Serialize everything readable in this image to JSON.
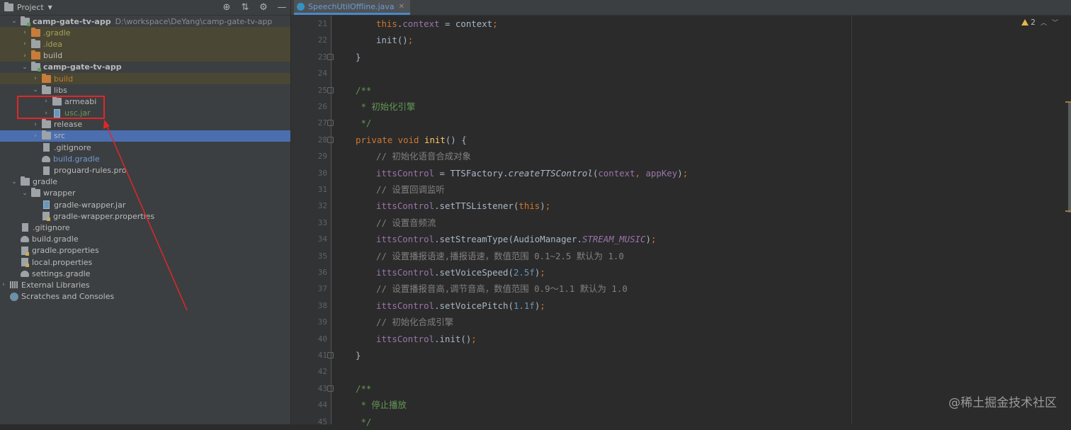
{
  "project_panel": {
    "title": "Project",
    "dropdown_icon": "chevron-down-icon",
    "toolbar_icons": [
      "locate-icon",
      "collapse-icon",
      "gear-icon",
      "minimize-icon"
    ],
    "tree": [
      {
        "label": "camp-gate-tv-app",
        "path": "D:\\workspace\\DeYang\\camp-gate-tv-app",
        "indent": 0,
        "expanded": true,
        "icon": "module-folder-icon",
        "style": "bold"
      },
      {
        "label": ".gradle",
        "indent": 1,
        "expanded": false,
        "icon": "folder-orange-icon",
        "style": "olive",
        "hl": true
      },
      {
        "label": ".idea",
        "indent": 1,
        "expanded": false,
        "icon": "folder-icon",
        "style": "olive",
        "hl": true
      },
      {
        "label": "build",
        "indent": 1,
        "expanded": false,
        "icon": "folder-orange-icon",
        "style": "normal",
        "hl": true
      },
      {
        "label": "camp-gate-tv-app",
        "indent": 1,
        "expanded": true,
        "icon": "module-folder-icon",
        "style": "bold"
      },
      {
        "label": "build",
        "indent": 2,
        "expanded": false,
        "icon": "folder-orange-icon",
        "style": "orange",
        "hl": true
      },
      {
        "label": "libs",
        "indent": 2,
        "expanded": true,
        "icon": "folder-icon",
        "style": "normal"
      },
      {
        "label": "armeabi",
        "indent": 3,
        "expanded": false,
        "icon": "folder-icon",
        "style": "normal"
      },
      {
        "label": "usc.jar",
        "indent": 3,
        "expanded": false,
        "icon": "jar-icon",
        "style": "green"
      },
      {
        "label": "release",
        "indent": 2,
        "expanded": false,
        "icon": "folder-icon",
        "style": "normal"
      },
      {
        "label": "src",
        "indent": 2,
        "expanded": false,
        "icon": "folder-icon",
        "style": "normal",
        "selected": true
      },
      {
        "label": ".gitignore",
        "indent": 2,
        "icon": "file-icon",
        "style": "normal"
      },
      {
        "label": "build.gradle",
        "indent": 2,
        "icon": "gradle-icon",
        "style": "blue"
      },
      {
        "label": "proguard-rules.pro",
        "indent": 2,
        "icon": "file-icon",
        "style": "normal"
      },
      {
        "label": "gradle",
        "indent": 0,
        "expanded": true,
        "icon": "folder-icon",
        "style": "normal"
      },
      {
        "label": "wrapper",
        "indent": 1,
        "expanded": true,
        "icon": "folder-icon",
        "style": "normal"
      },
      {
        "label": "gradle-wrapper.jar",
        "indent": 2,
        "icon": "jar-icon",
        "style": "normal"
      },
      {
        "label": "gradle-wrapper.properties",
        "indent": 2,
        "icon": "properties-icon",
        "style": "normal"
      },
      {
        "label": ".gitignore",
        "indent": 0,
        "icon": "file-icon",
        "style": "normal"
      },
      {
        "label": "build.gradle",
        "indent": 0,
        "icon": "gradle-icon",
        "style": "normal"
      },
      {
        "label": "gradle.properties",
        "indent": 0,
        "icon": "properties-icon",
        "style": "normal"
      },
      {
        "label": "local.properties",
        "indent": 0,
        "icon": "properties-icon",
        "style": "normal"
      },
      {
        "label": "settings.gradle",
        "indent": 0,
        "icon": "gradle-icon",
        "style": "normal"
      },
      {
        "label": "External Libraries",
        "indent": -1,
        "expanded": false,
        "icon": "libraries-icon",
        "style": "normal"
      },
      {
        "label": "Scratches and Consoles",
        "indent": -1,
        "icon": "scratches-icon",
        "style": "normal"
      }
    ]
  },
  "editor": {
    "tab": {
      "label": "SpeechUtilOffline.java",
      "close_icon": "close-icon"
    },
    "warnings": {
      "icon": "warning-icon",
      "count": "2"
    },
    "watermark": "@稀土掘金技术社区",
    "lines": [
      {
        "n": "21",
        "indent": 2,
        "parts": [
          [
            "kw",
            "this"
          ],
          [
            "p",
            "."
          ],
          [
            "fld",
            "context"
          ],
          [
            "p",
            " = context"
          ],
          [
            "kw",
            ";"
          ]
        ]
      },
      {
        "n": "22",
        "indent": 2,
        "parts": [
          [
            "fn2",
            "init"
          ],
          [
            "p",
            "()"
          ],
          [
            "kw",
            ";"
          ]
        ]
      },
      {
        "n": "23",
        "indent": 1,
        "parts": [
          [
            "p",
            "}"
          ]
        ]
      },
      {
        "n": "24",
        "indent": 0,
        "parts": []
      },
      {
        "n": "25",
        "indent": 1,
        "parts": [
          [
            "doc",
            "/**"
          ]
        ]
      },
      {
        "n": "26",
        "indent": 1,
        "parts": [
          [
            "doc",
            " * 初始化引擎"
          ]
        ]
      },
      {
        "n": "27",
        "indent": 1,
        "parts": [
          [
            "doc",
            " */"
          ]
        ]
      },
      {
        "n": "28",
        "indent": 1,
        "parts": [
          [
            "kw",
            "private void "
          ],
          [
            "fn",
            "init"
          ],
          [
            "p",
            "() {"
          ]
        ]
      },
      {
        "n": "29",
        "indent": 2,
        "parts": [
          [
            "cmt",
            "// 初始化语音合成对象"
          ]
        ]
      },
      {
        "n": "30",
        "indent": 2,
        "parts": [
          [
            "fld",
            "ittsControl"
          ],
          [
            "p",
            " = TTSFactory."
          ],
          [
            "it",
            "createTTSControl"
          ],
          [
            "p",
            "("
          ],
          [
            "fld",
            "context"
          ],
          [
            "kw",
            ", "
          ],
          [
            "fld",
            "appKey"
          ],
          [
            "p",
            ")"
          ],
          [
            "kw",
            ";"
          ]
        ]
      },
      {
        "n": "31",
        "indent": 2,
        "parts": [
          [
            "cmt",
            "// 设置回调监听"
          ]
        ]
      },
      {
        "n": "32",
        "indent": 2,
        "parts": [
          [
            "fld",
            "ittsControl"
          ],
          [
            "p",
            ".setTTSListener("
          ],
          [
            "kw",
            "this"
          ],
          [
            "p",
            ")"
          ],
          [
            "kw",
            ";"
          ]
        ]
      },
      {
        "n": "33",
        "indent": 2,
        "parts": [
          [
            "cmt",
            "// 设置音频流"
          ]
        ]
      },
      {
        "n": "34",
        "indent": 2,
        "parts": [
          [
            "fld",
            "ittsControl"
          ],
          [
            "p",
            ".setStreamType(AudioManager."
          ],
          [
            "stat",
            "STREAM_MUSIC"
          ],
          [
            "p",
            ")"
          ],
          [
            "kw",
            ";"
          ]
        ]
      },
      {
        "n": "35",
        "indent": 2,
        "parts": [
          [
            "cmt",
            "// 设置播报语速,播报语速，数值范围 0.1~2.5 默认为 1.0"
          ]
        ]
      },
      {
        "n": "36",
        "indent": 2,
        "parts": [
          [
            "fld",
            "ittsControl"
          ],
          [
            "p",
            ".setVoiceSpeed("
          ],
          [
            "num",
            "2.5f"
          ],
          [
            "p",
            ")"
          ],
          [
            "kw",
            ";"
          ]
        ]
      },
      {
        "n": "37",
        "indent": 2,
        "parts": [
          [
            "cmt",
            "// 设置播报音高,调节音高，数值范围 0.9～1.1 默认为 1.0"
          ]
        ]
      },
      {
        "n": "38",
        "indent": 2,
        "parts": [
          [
            "fld",
            "ittsControl"
          ],
          [
            "p",
            ".setVoicePitch("
          ],
          [
            "num",
            "1.1f"
          ],
          [
            "p",
            ")"
          ],
          [
            "kw",
            ";"
          ]
        ]
      },
      {
        "n": "39",
        "indent": 2,
        "parts": [
          [
            "cmt",
            "// 初始化合成引擎"
          ]
        ]
      },
      {
        "n": "40",
        "indent": 2,
        "parts": [
          [
            "fld",
            "ittsControl"
          ],
          [
            "p",
            ".init()"
          ],
          [
            "kw",
            ";"
          ]
        ]
      },
      {
        "n": "41",
        "indent": 1,
        "parts": [
          [
            "p",
            "}"
          ]
        ]
      },
      {
        "n": "42",
        "indent": 0,
        "parts": []
      },
      {
        "n": "43",
        "indent": 1,
        "parts": [
          [
            "doc",
            "/**"
          ]
        ]
      },
      {
        "n": "44",
        "indent": 1,
        "parts": [
          [
            "doc",
            " * 停止播放"
          ]
        ]
      },
      {
        "n": "45",
        "indent": 1,
        "parts": [
          [
            "doc",
            " */"
          ]
        ]
      }
    ]
  }
}
